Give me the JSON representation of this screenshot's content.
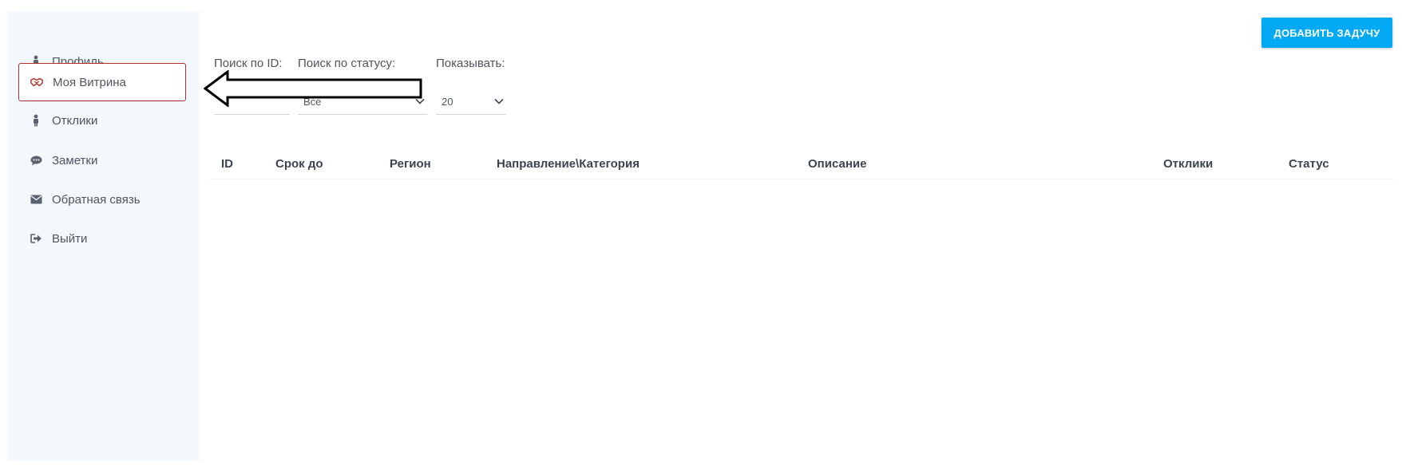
{
  "sidebar": {
    "items": [
      {
        "label": "Профиль",
        "icon": "person-icon"
      },
      {
        "label": "Моя Витрина",
        "icon": "handshake-icon",
        "active": true
      },
      {
        "label": "Отклики",
        "icon": "person-icon"
      },
      {
        "label": "Заметки",
        "icon": "comment-icon"
      },
      {
        "label": "Обратная связь",
        "icon": "envelope-icon"
      },
      {
        "label": "Выйти",
        "icon": "sign-out-icon"
      }
    ]
  },
  "header": {
    "add_task_label": "ДОБАВИТЬ ЗАДУЧУ"
  },
  "filters": {
    "search_id_label": "Поиск по ID:",
    "search_id_value": "",
    "search_status_label": "Поиск по статусу:",
    "search_status_value": "Все",
    "show_label": "Показывать:",
    "show_value": "20"
  },
  "table": {
    "headers": [
      "ID",
      "Срок до",
      "Регион",
      "Направление\\Категория",
      "Описание",
      "Отклики",
      "Статус"
    ],
    "rows": []
  },
  "colors": {
    "accent": "#03a9f4",
    "active_border": "#b0302b",
    "sidebar_bg": "#f3f8fc"
  }
}
